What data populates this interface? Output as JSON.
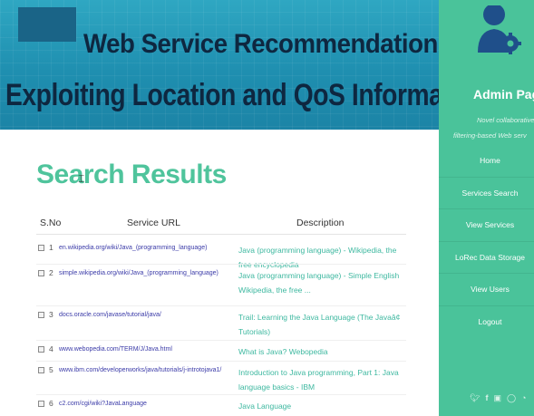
{
  "banner": {
    "line1": "Web Service Recommendation via",
    "line2": "Exploiting Location and QoS Information"
  },
  "sidebar": {
    "title": "Admin Page",
    "tagline1": "Novel collaborative",
    "tagline2": "filtering-based Web serv",
    "nav": [
      {
        "label": "Home"
      },
      {
        "label": "Services Search"
      },
      {
        "label": "View Services"
      },
      {
        "label": "LoRec Data Storage"
      },
      {
        "label": "View Users"
      },
      {
        "label": "Logout"
      }
    ],
    "social_icons": [
      "twitter-icon",
      "facebook-icon",
      "instagram-icon",
      "github-icon",
      "rss-icon"
    ]
  },
  "main": {
    "heading": "Search Results",
    "columns": {
      "sno": "S.No",
      "url": "Service URL",
      "description": "Description"
    },
    "rows": [
      {
        "num": "1",
        "url": "en.wikipedia.org/wiki/Java_(programming_language)",
        "description": "Java (programming language) - Wikipedia, the free encyclopedia"
      },
      {
        "num": "2",
        "url": "simple.wikipedia.org/wiki/Java_(programming_language)",
        "description": "Java (programming language) - Simple English Wikipedia, the free ..."
      },
      {
        "num": "3",
        "url": "docs.oracle.com/javase/tutorial/java/",
        "description": "Trail: Learning the Java Language (The Javaâ¢ Tutorials)"
      },
      {
        "num": "4",
        "url": "www.webopedia.com/TERM/J/Java.html",
        "description": "What is Java? Webopedia"
      },
      {
        "num": "5",
        "url": "www.ibm.com/developerworks/java/tutorials/j-introtojava1/",
        "description": "Introduction to Java programming, Part 1: Java language basics - IBM"
      },
      {
        "num": "6",
        "url": "c2.com/cgi/wiki?JavaLanguage",
        "description": "Java Language"
      }
    ]
  },
  "colors": {
    "accent": "#4ac39a",
    "heading": "#4fc49c",
    "link": "#3b3ba8",
    "description": "#3eb8a0",
    "banner": "#1f8fb0"
  }
}
